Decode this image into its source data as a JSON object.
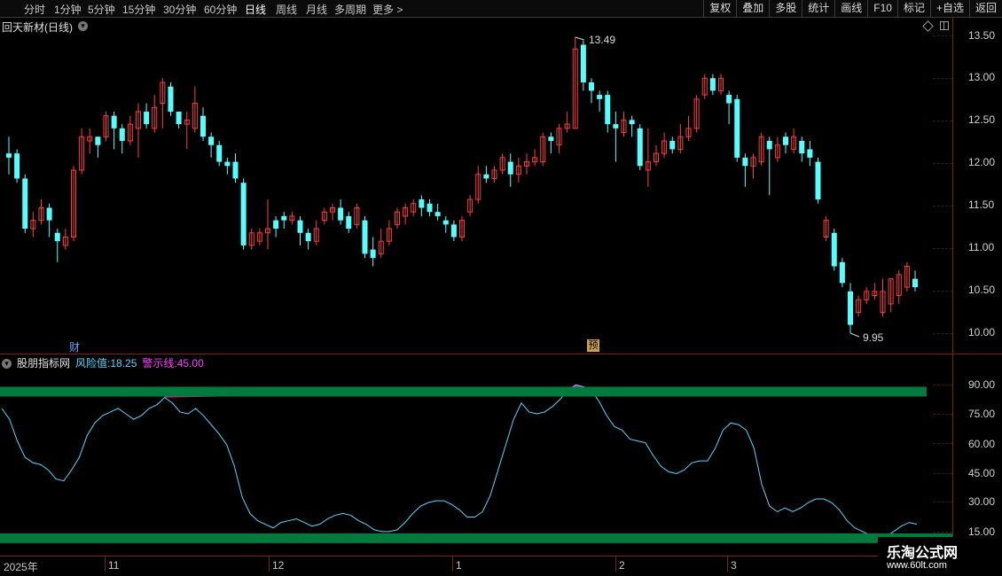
{
  "toolbar": {
    "timeframes": [
      "分时",
      "1分钟",
      "5分钟",
      "15分钟",
      "30分钟",
      "60分钟",
      "日线",
      "周线",
      "月线",
      "多周期",
      "更多 >"
    ],
    "active": "日线",
    "tools": [
      "复权",
      "叠加",
      "多股",
      "统计",
      "画线",
      "F10",
      "标记",
      "+自选",
      "返回"
    ]
  },
  "stock": {
    "title": "回天新材(日线)",
    "marker_cai": "财",
    "marker_yu": "预"
  },
  "price_axis": {
    "labels": [
      "13.50",
      "13.00",
      "12.50",
      "12.00",
      "11.50",
      "11.00",
      "10.50",
      "10.00"
    ]
  },
  "annotations": {
    "high": "13.49",
    "low": "9.95"
  },
  "indicator": {
    "name": "股朋指标网",
    "risk_label": "风险值:",
    "risk_value": "18.25",
    "warn_label": "警示线:",
    "warn_value": "45.00",
    "axis_labels": [
      "90.00",
      "75.00",
      "60.00",
      "45.00",
      "30.00",
      "15.00"
    ]
  },
  "dates": {
    "labels": [
      "2025年",
      "11",
      "12",
      "1",
      "2",
      "3"
    ]
  },
  "watermark": {
    "brand": "乐淘公式网",
    "url": "www.60lt.com"
  },
  "colors": {
    "up": "#ff3c3c",
    "down": "#54ffff",
    "band": "#007a3d",
    "risk_line": "#54d8ff",
    "magenta": "#ff1493",
    "yellow": "#ffff00",
    "axis": "#7a1f1f"
  },
  "chart_data": {
    "type": "candlestick",
    "price_ylim": [
      9.95,
      13.49
    ],
    "candles": [
      [
        12.1,
        12.05,
        12.3,
        11.85
      ],
      [
        12.1,
        11.8,
        12.15,
        11.75
      ],
      [
        11.8,
        11.2,
        11.85,
        11.15
      ],
      [
        11.2,
        11.3,
        11.4,
        11.1
      ],
      [
        11.3,
        11.45,
        11.55,
        11.25
      ],
      [
        11.45,
        11.3,
        11.5,
        11.1
      ],
      [
        11.15,
        11.05,
        11.2,
        10.8
      ],
      [
        11.0,
        11.1,
        11.2,
        10.95
      ],
      [
        11.1,
        11.9,
        11.95,
        11.05
      ],
      [
        11.9,
        12.3,
        12.4,
        11.85
      ],
      [
        12.25,
        12.3,
        12.4,
        12.1
      ],
      [
        12.3,
        12.2,
        12.3,
        12.05
      ],
      [
        12.3,
        12.55,
        12.6,
        12.25
      ],
      [
        12.55,
        12.4,
        12.6,
        12.15
      ],
      [
        12.4,
        12.25,
        12.45,
        12.1
      ],
      [
        12.25,
        12.45,
        12.55,
        12.2
      ],
      [
        12.4,
        12.6,
        12.7,
        12.05
      ],
      [
        12.6,
        12.45,
        12.7,
        12.4
      ],
      [
        12.4,
        12.65,
        12.8,
        12.35
      ],
      [
        12.7,
        12.95,
        13.0,
        12.4
      ],
      [
        12.9,
        12.6,
        12.95,
        12.55
      ],
      [
        12.6,
        12.45,
        12.6,
        12.4
      ],
      [
        12.45,
        12.5,
        12.6,
        12.15
      ],
      [
        12.4,
        12.7,
        12.9,
        12.35
      ],
      [
        12.55,
        12.3,
        12.65,
        12.25
      ],
      [
        12.3,
        12.2,
        12.35,
        12.05
      ],
      [
        12.2,
        12.0,
        12.25,
        11.95
      ],
      [
        12.0,
        11.95,
        12.05,
        11.85
      ],
      [
        12.0,
        11.8,
        12.1,
        11.75
      ],
      [
        11.75,
        11.0,
        11.8,
        10.95
      ],
      [
        11.0,
        11.15,
        11.2,
        10.95
      ],
      [
        11.05,
        11.15,
        11.2,
        11.0
      ],
      [
        11.15,
        11.2,
        11.55,
        10.95
      ],
      [
        11.3,
        11.2,
        11.35,
        11.1
      ],
      [
        11.35,
        11.3,
        11.4,
        11.2
      ],
      [
        11.3,
        11.35,
        11.4,
        11.25
      ],
      [
        11.3,
        11.15,
        11.35,
        11.0
      ],
      [
        11.15,
        11.05,
        11.2,
        10.95
      ],
      [
        11.05,
        11.2,
        11.3,
        11.0
      ],
      [
        11.3,
        11.4,
        11.45,
        11.25
      ],
      [
        11.4,
        11.45,
        11.5,
        11.3
      ],
      [
        11.45,
        11.3,
        11.55,
        11.25
      ],
      [
        11.35,
        11.2,
        11.4,
        11.15
      ],
      [
        11.25,
        11.45,
        11.5,
        11.2
      ],
      [
        11.3,
        10.9,
        11.35,
        10.85
      ],
      [
        10.95,
        10.85,
        11.1,
        10.75
      ],
      [
        10.9,
        11.05,
        11.2,
        10.85
      ],
      [
        11.05,
        11.2,
        11.3,
        11.0
      ],
      [
        11.25,
        11.4,
        11.45,
        11.2
      ],
      [
        11.35,
        11.45,
        11.5,
        11.25
      ],
      [
        11.4,
        11.5,
        11.55,
        11.35
      ],
      [
        11.55,
        11.45,
        11.6,
        11.35
      ],
      [
        11.5,
        11.4,
        11.55,
        11.35
      ],
      [
        11.4,
        11.35,
        11.5,
        11.3
      ],
      [
        11.3,
        11.25,
        11.35,
        11.15
      ],
      [
        11.25,
        11.1,
        11.3,
        11.05
      ],
      [
        11.1,
        11.3,
        11.35,
        11.05
      ],
      [
        11.4,
        11.55,
        11.6,
        11.35
      ],
      [
        11.55,
        11.85,
        11.95,
        11.5
      ],
      [
        11.85,
        11.8,
        11.95,
        11.75
      ],
      [
        11.8,
        11.9,
        11.95,
        11.75
      ],
      [
        11.9,
        12.05,
        12.1,
        11.85
      ],
      [
        12.0,
        11.85,
        12.1,
        11.7
      ],
      [
        11.85,
        11.95,
        12.05,
        11.75
      ],
      [
        11.95,
        12.0,
        12.1,
        11.85
      ],
      [
        12.0,
        12.05,
        12.15,
        11.95
      ],
      [
        12.0,
        12.3,
        12.35,
        11.95
      ],
      [
        12.3,
        12.25,
        12.35,
        12.1
      ],
      [
        12.2,
        12.4,
        12.45,
        12.1
      ],
      [
        12.4,
        12.45,
        12.6,
        12.35
      ],
      [
        12.4,
        13.35,
        13.49,
        12.4
      ],
      [
        13.4,
        12.95,
        13.45,
        12.85
      ],
      [
        12.95,
        12.85,
        13.0,
        12.7
      ],
      [
        12.8,
        12.75,
        12.85,
        12.6
      ],
      [
        12.8,
        12.45,
        12.85,
        12.35
      ],
      [
        12.45,
        12.4,
        12.6,
        12.0
      ],
      [
        12.35,
        12.5,
        12.6,
        12.3
      ],
      [
        12.5,
        12.45,
        12.55,
        12.3
      ],
      [
        12.4,
        11.95,
        12.45,
        11.9
      ],
      [
        11.9,
        12.0,
        12.4,
        11.7
      ],
      [
        12.0,
        12.1,
        12.2,
        11.95
      ],
      [
        12.1,
        12.25,
        12.35,
        12.05
      ],
      [
        12.25,
        12.15,
        12.3,
        12.1
      ],
      [
        12.15,
        12.3,
        12.45,
        12.1
      ],
      [
        12.3,
        12.4,
        12.55,
        12.25
      ],
      [
        12.4,
        12.75,
        12.8,
        12.35
      ],
      [
        12.8,
        13.0,
        13.05,
        12.75
      ],
      [
        13.0,
        12.85,
        13.05,
        12.8
      ],
      [
        12.85,
        13.0,
        13.05,
        12.8
      ],
      [
        12.8,
        12.7,
        12.85,
        12.45
      ],
      [
        12.75,
        12.05,
        12.8,
        12.0
      ],
      [
        12.05,
        11.95,
        12.1,
        11.7
      ],
      [
        11.95,
        12.05,
        12.1,
        11.8
      ],
      [
        12.0,
        12.3,
        12.35,
        11.95
      ],
      [
        12.25,
        12.15,
        12.3,
        11.6
      ],
      [
        12.05,
        12.2,
        12.3,
        12.0
      ],
      [
        12.3,
        12.2,
        12.35,
        12.1
      ],
      [
        12.15,
        12.3,
        12.4,
        12.1
      ],
      [
        12.25,
        12.1,
        12.3,
        12.0
      ],
      [
        12.15,
        12.05,
        12.25,
        11.95
      ],
      [
        12.0,
        11.55,
        12.05,
        11.5
      ],
      [
        11.1,
        11.3,
        11.35,
        11.05
      ],
      [
        11.15,
        10.75,
        11.2,
        10.7
      ],
      [
        10.8,
        10.55,
        10.85,
        10.5
      ],
      [
        10.45,
        10.05,
        10.55,
        9.95
      ],
      [
        10.2,
        10.35,
        10.4,
        10.15
      ],
      [
        10.35,
        10.45,
        10.5,
        10.3
      ],
      [
        10.4,
        10.45,
        10.55,
        10.35
      ],
      [
        10.2,
        10.45,
        10.6,
        10.15
      ],
      [
        10.3,
        10.6,
        10.6,
        10.2
      ],
      [
        10.4,
        10.65,
        10.7,
        10.3
      ],
      [
        10.5,
        10.75,
        10.8,
        10.45
      ],
      [
        10.6,
        10.5,
        10.7,
        10.45
      ]
    ],
    "indicator_ylim": [
      10,
      102
    ],
    "risk_series": [
      82,
      76,
      64,
      55,
      52,
      51,
      48,
      43,
      42,
      48,
      55,
      67,
      74,
      78,
      80,
      82,
      79,
      76,
      78,
      82,
      84,
      88,
      85,
      80,
      79,
      82,
      78,
      73,
      68,
      62,
      50,
      33,
      24,
      20,
      18,
      16,
      19,
      20,
      21,
      19,
      17,
      18,
      21,
      23,
      24,
      23,
      20,
      18,
      15,
      14,
      14,
      15,
      19,
      24,
      28,
      30,
      31,
      31,
      29,
      26,
      22,
      22,
      25,
      34,
      48,
      62,
      76,
      85,
      80,
      79,
      80,
      83,
      87,
      92,
      95,
      94,
      92,
      86,
      78,
      72,
      70,
      65,
      64,
      63,
      56,
      50,
      47,
      46,
      48,
      52,
      53,
      53,
      60,
      70,
      74,
      73,
      70,
      60,
      40,
      28,
      25,
      27,
      25,
      27,
      30,
      32,
      32,
      30,
      26,
      20,
      16,
      14,
      12,
      11,
      11,
      14,
      17,
      19,
      18
    ],
    "warn_line": 45.0,
    "upper_band": 91,
    "lower_band": 12
  }
}
